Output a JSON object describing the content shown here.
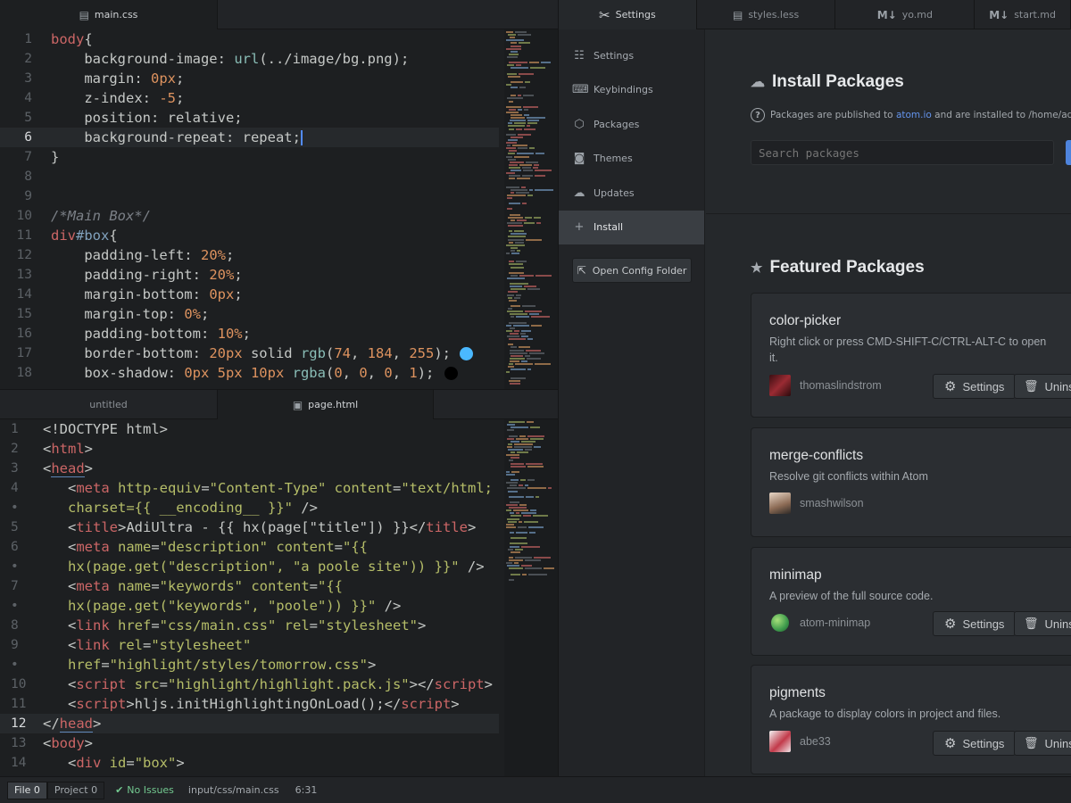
{
  "top_editor": {
    "tab": {
      "icon": "css3-icon",
      "label": "main.css"
    },
    "lines": [
      {
        "n": "1",
        "parts": [
          [
            "t-sel",
            "body"
          ],
          [
            "",
            "{"
          ]
        ]
      },
      {
        "n": "2",
        "parts": [
          [
            "",
            "    background-image: "
          ],
          [
            "t-fn",
            "url"
          ],
          [
            "",
            "(../image/bg.png);"
          ]
        ]
      },
      {
        "n": "3",
        "parts": [
          [
            "",
            "    margin: "
          ],
          [
            "t-num",
            "0px"
          ],
          [
            "",
            ";"
          ]
        ]
      },
      {
        "n": "4",
        "parts": [
          [
            "",
            "    z-index: "
          ],
          [
            "t-num",
            "-5"
          ],
          [
            "",
            ";"
          ]
        ]
      },
      {
        "n": "5",
        "parts": [
          [
            "",
            "    position: relative;"
          ]
        ]
      },
      {
        "n": "6",
        "parts": [
          [
            "",
            "    background-repeat: repeat;"
          ]
        ],
        "current": true
      },
      {
        "n": "7",
        "parts": [
          [
            "",
            "}"
          ]
        ]
      },
      {
        "n": "8",
        "parts": []
      },
      {
        "n": "9",
        "parts": []
      },
      {
        "n": "10",
        "parts": [
          [
            "t-com",
            "/*Main Box*/"
          ]
        ]
      },
      {
        "n": "11",
        "parts": [
          [
            "t-sel",
            "div"
          ],
          [
            "t-id",
            "#box"
          ],
          [
            "",
            "{"
          ]
        ]
      },
      {
        "n": "12",
        "parts": [
          [
            "",
            "    padding-left: "
          ],
          [
            "t-num",
            "20%"
          ],
          [
            "",
            ";"
          ]
        ]
      },
      {
        "n": "13",
        "parts": [
          [
            "",
            "    padding-right: "
          ],
          [
            "t-num",
            "20%"
          ],
          [
            "",
            ";"
          ]
        ]
      },
      {
        "n": "14",
        "parts": [
          [
            "",
            "    margin-bottom: "
          ],
          [
            "t-num",
            "0px"
          ],
          [
            "",
            ";"
          ]
        ]
      },
      {
        "n": "15",
        "parts": [
          [
            "",
            "    margin-top: "
          ],
          [
            "t-num",
            "0%"
          ],
          [
            "",
            ";"
          ]
        ]
      },
      {
        "n": "16",
        "parts": [
          [
            "",
            "    padding-bottom: "
          ],
          [
            "t-num",
            "10%"
          ],
          [
            "",
            ";"
          ]
        ]
      },
      {
        "n": "17",
        "parts": [
          [
            "",
            "    border-bottom: "
          ],
          [
            "t-num",
            "20px"
          ],
          [
            "",
            " solid "
          ],
          [
            "t-fn",
            "rgb"
          ],
          [
            "",
            "("
          ],
          [
            "t-num",
            "74"
          ],
          [
            "",
            ", "
          ],
          [
            "t-num",
            "184"
          ],
          [
            "",
            ", "
          ],
          [
            "t-num",
            "255"
          ],
          [
            "",
            ");"
          ]
        ],
        "swatch": "#4ab8ff"
      },
      {
        "n": "18",
        "parts": [
          [
            "",
            "    box-shadow: "
          ],
          [
            "t-num",
            "0px 5px 10px"
          ],
          [
            "",
            " "
          ],
          [
            "t-fn",
            "rgba"
          ],
          [
            "",
            "("
          ],
          [
            "t-num",
            "0"
          ],
          [
            "",
            ", "
          ],
          [
            "t-num",
            "0"
          ],
          [
            "",
            ", "
          ],
          [
            "t-num",
            "0"
          ],
          [
            "",
            ", "
          ],
          [
            "t-num",
            "1"
          ],
          [
            "",
            ");"
          ]
        ],
        "swatch": "#000000"
      }
    ]
  },
  "bottom_editor": {
    "tabs": [
      {
        "label": "untitled",
        "icon": ""
      },
      {
        "label": "page.html",
        "icon": "html5-icon",
        "active": true
      }
    ],
    "lines": [
      {
        "n": "1",
        "parts": [
          [
            "",
            "<!DOCTYPE html>"
          ]
        ]
      },
      {
        "n": "2",
        "parts": [
          [
            "",
            "<"
          ],
          [
            "t-tag",
            "html"
          ],
          [
            "",
            ">"
          ]
        ]
      },
      {
        "n": "3",
        "parts": [
          [
            "",
            "<"
          ],
          [
            "t-tag uline",
            "head"
          ],
          [
            "",
            ">"
          ]
        ]
      },
      {
        "n": "4",
        "parts": [
          [
            "",
            "   <"
          ],
          [
            "t-tag",
            "meta"
          ],
          [
            "",
            " "
          ],
          [
            "t-attr",
            "http-equiv"
          ],
          [
            "",
            "="
          ],
          [
            "t-str",
            "\"Content-Type\""
          ],
          [
            "",
            " "
          ],
          [
            "t-attr",
            "content"
          ],
          [
            "",
            "="
          ],
          [
            "t-str",
            "\"text/html;"
          ]
        ]
      },
      {
        "n": "•",
        "parts": [
          [
            "t-str",
            "   charset={{ __encoding__ }}\""
          ],
          [
            "",
            " />"
          ]
        ]
      },
      {
        "n": "5",
        "parts": [
          [
            "",
            "   <"
          ],
          [
            "t-tag",
            "title"
          ],
          [
            "",
            ">AdiUltra - {{ hx(page[\"title\"]) }}</"
          ],
          [
            "t-tag",
            "title"
          ],
          [
            "",
            ">"
          ]
        ]
      },
      {
        "n": "6",
        "parts": [
          [
            "",
            "   <"
          ],
          [
            "t-tag",
            "meta"
          ],
          [
            "",
            " "
          ],
          [
            "t-attr",
            "name"
          ],
          [
            "",
            "="
          ],
          [
            "t-str",
            "\"description\""
          ],
          [
            "",
            " "
          ],
          [
            "t-attr",
            "content"
          ],
          [
            "",
            "="
          ],
          [
            "t-str",
            "\"{{"
          ]
        ]
      },
      {
        "n": "•",
        "parts": [
          [
            "t-str",
            "   hx(page.get(\"description\", \"a poole site\")) }}\""
          ],
          [
            "",
            " />"
          ]
        ]
      },
      {
        "n": "7",
        "parts": [
          [
            "",
            "   <"
          ],
          [
            "t-tag",
            "meta"
          ],
          [
            "",
            " "
          ],
          [
            "t-attr",
            "name"
          ],
          [
            "",
            "="
          ],
          [
            "t-str",
            "\"keywords\""
          ],
          [
            "",
            " "
          ],
          [
            "t-attr",
            "content"
          ],
          [
            "",
            "="
          ],
          [
            "t-str",
            "\"{{"
          ]
        ]
      },
      {
        "n": "•",
        "parts": [
          [
            "t-str",
            "   hx(page.get(\"keywords\", \"poole\")) }}\""
          ],
          [
            "",
            " />"
          ]
        ]
      },
      {
        "n": "8",
        "parts": [
          [
            "",
            "   <"
          ],
          [
            "t-tag",
            "link"
          ],
          [
            "",
            " "
          ],
          [
            "t-attr",
            "href"
          ],
          [
            "",
            "="
          ],
          [
            "t-str",
            "\"css/main.css\""
          ],
          [
            "",
            " "
          ],
          [
            "t-attr",
            "rel"
          ],
          [
            "",
            "="
          ],
          [
            "t-str",
            "\"stylesheet\""
          ],
          [
            "",
            ">"
          ]
        ]
      },
      {
        "n": "9",
        "parts": [
          [
            "",
            "   <"
          ],
          [
            "t-tag",
            "link"
          ],
          [
            "",
            " "
          ],
          [
            "t-attr",
            "rel"
          ],
          [
            "",
            "="
          ],
          [
            "t-str",
            "\"stylesheet\""
          ]
        ]
      },
      {
        "n": "•",
        "parts": [
          [
            "",
            "   "
          ],
          [
            "t-attr",
            "href"
          ],
          [
            "",
            "="
          ],
          [
            "t-str",
            "\"highlight/styles/tomorrow.css\""
          ],
          [
            "",
            ">"
          ]
        ]
      },
      {
        "n": "10",
        "parts": [
          [
            "",
            "   <"
          ],
          [
            "t-tag",
            "script"
          ],
          [
            "",
            " "
          ],
          [
            "t-attr",
            "src"
          ],
          [
            "",
            "="
          ],
          [
            "t-str",
            "\"highlight/highlight.pack.js\""
          ],
          [
            "",
            "></"
          ],
          [
            "t-tag",
            "script"
          ],
          [
            "",
            ">"
          ]
        ]
      },
      {
        "n": "11",
        "parts": [
          [
            "",
            "   <"
          ],
          [
            "t-tag",
            "script"
          ],
          [
            "",
            ">hljs.initHighlightingOnLoad();</"
          ],
          [
            "t-tag",
            "script"
          ],
          [
            "",
            ">"
          ]
        ]
      },
      {
        "n": "12",
        "parts": [
          [
            "",
            "</"
          ],
          [
            "t-tag uline",
            "head"
          ],
          [
            "",
            ">"
          ]
        ],
        "current": true
      },
      {
        "n": "13",
        "parts": [
          [
            "",
            "<"
          ],
          [
            "t-tag",
            "body"
          ],
          [
            "",
            ">"
          ]
        ]
      },
      {
        "n": "14",
        "parts": [
          [
            "",
            "   <"
          ],
          [
            "t-tag",
            "div"
          ],
          [
            "",
            " "
          ],
          [
            "t-attr",
            "id"
          ],
          [
            "",
            "="
          ],
          [
            "t-str",
            "\"box\""
          ],
          [
            "",
            ">"
          ]
        ]
      }
    ]
  },
  "right_tabs": [
    {
      "label": "Settings",
      "icon": "tools-icon",
      "active": true
    },
    {
      "label": "styles.less",
      "icon": "css3-icon"
    },
    {
      "label": "yo.md",
      "icon": "markdown-icon"
    },
    {
      "label": "start.md",
      "icon": "markdown-icon"
    }
  ],
  "settings_nav": [
    {
      "label": "Settings",
      "icon": "sliders-icon",
      "glyph": "☷"
    },
    {
      "label": "Keybindings",
      "icon": "keyboard-icon",
      "glyph": "⌨"
    },
    {
      "label": "Packages",
      "icon": "package-icon",
      "glyph": "⬡"
    },
    {
      "label": "Themes",
      "icon": "paintcan-icon",
      "glyph": "◙"
    },
    {
      "label": "Updates",
      "icon": "cloud-download-icon",
      "glyph": "☁"
    },
    {
      "label": "Install",
      "icon": "plus-icon",
      "glyph": "+",
      "active": true
    }
  ],
  "open_config": "Open Config Folder",
  "install": {
    "title": "Install Packages",
    "info_prefix": "Packages are published to ",
    "info_link": "atom.io",
    "info_suffix": " and are installed to /home/adiultra/.",
    "search_placeholder": "Search packages"
  },
  "featured": {
    "title": "Featured Packages",
    "packages": [
      {
        "name": "color-picker",
        "desc": "Right click or press CMD-SHIFT-C/CTRL-ALT-C to open it.",
        "author": "thomaslindstrom",
        "settings": "Settings",
        "uninstall": "Unins",
        "avatar": "#6a1d22"
      },
      {
        "name": "merge-conflicts",
        "desc": "Resolve git conflicts within Atom",
        "author": "smashwilson",
        "avatar": "#b88a6a"
      },
      {
        "name": "minimap",
        "desc": "A preview of the full source code.",
        "author": "atom-minimap",
        "settings": "Settings",
        "uninstall": "Unins",
        "avatar": "#4aa35a"
      },
      {
        "name": "pigments",
        "desc": "A package to display colors in project and files.",
        "author": "abe33",
        "settings": "Settings",
        "uninstall": "Unins",
        "avatar": "#c23a4a"
      }
    ]
  },
  "status": {
    "file": "File",
    "file_count": "0",
    "project": "Project",
    "project_count": "0",
    "no_issues": "No Issues",
    "path": "input/css/main.css",
    "cursor": "6:31"
  }
}
